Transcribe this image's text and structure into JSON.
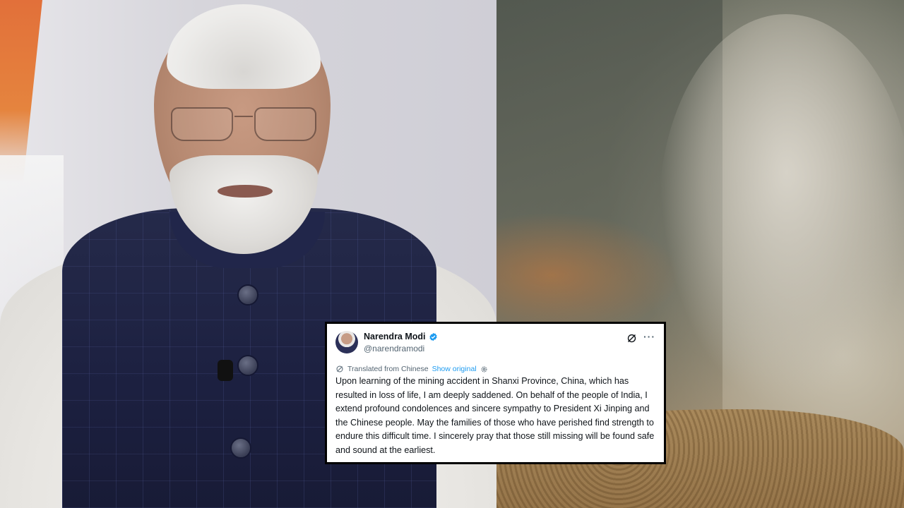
{
  "tweet": {
    "author_name": "Narendra Modi",
    "handle": "@narendramodi",
    "verified": true,
    "translated_label": "Translated from Chinese",
    "show_original_label": "Show original",
    "text": "Upon learning of the mining accident in Shanxi Province, China, which has resulted in loss of life, I am deeply saddened. On behalf of the people of India, I extend profound condolences and sincere sympathy to President Xi Jinping and the Chinese people. May the families of those who have perished find strength to endure this difficult time. I sincerely pray that those still missing will be found safe and sound at the earliest.",
    "icons": [
      "verified-badge-icon",
      "grok-icon",
      "more-options-icon",
      "translate-icon",
      "settings-icon"
    ]
  },
  "colors": {
    "link": "#1d9bf0",
    "text": "#0f1419",
    "secondary_text": "#536471",
    "card_border": "#000000"
  },
  "photos": {
    "left": "portrait-photo",
    "right": "landslide-photo"
  }
}
